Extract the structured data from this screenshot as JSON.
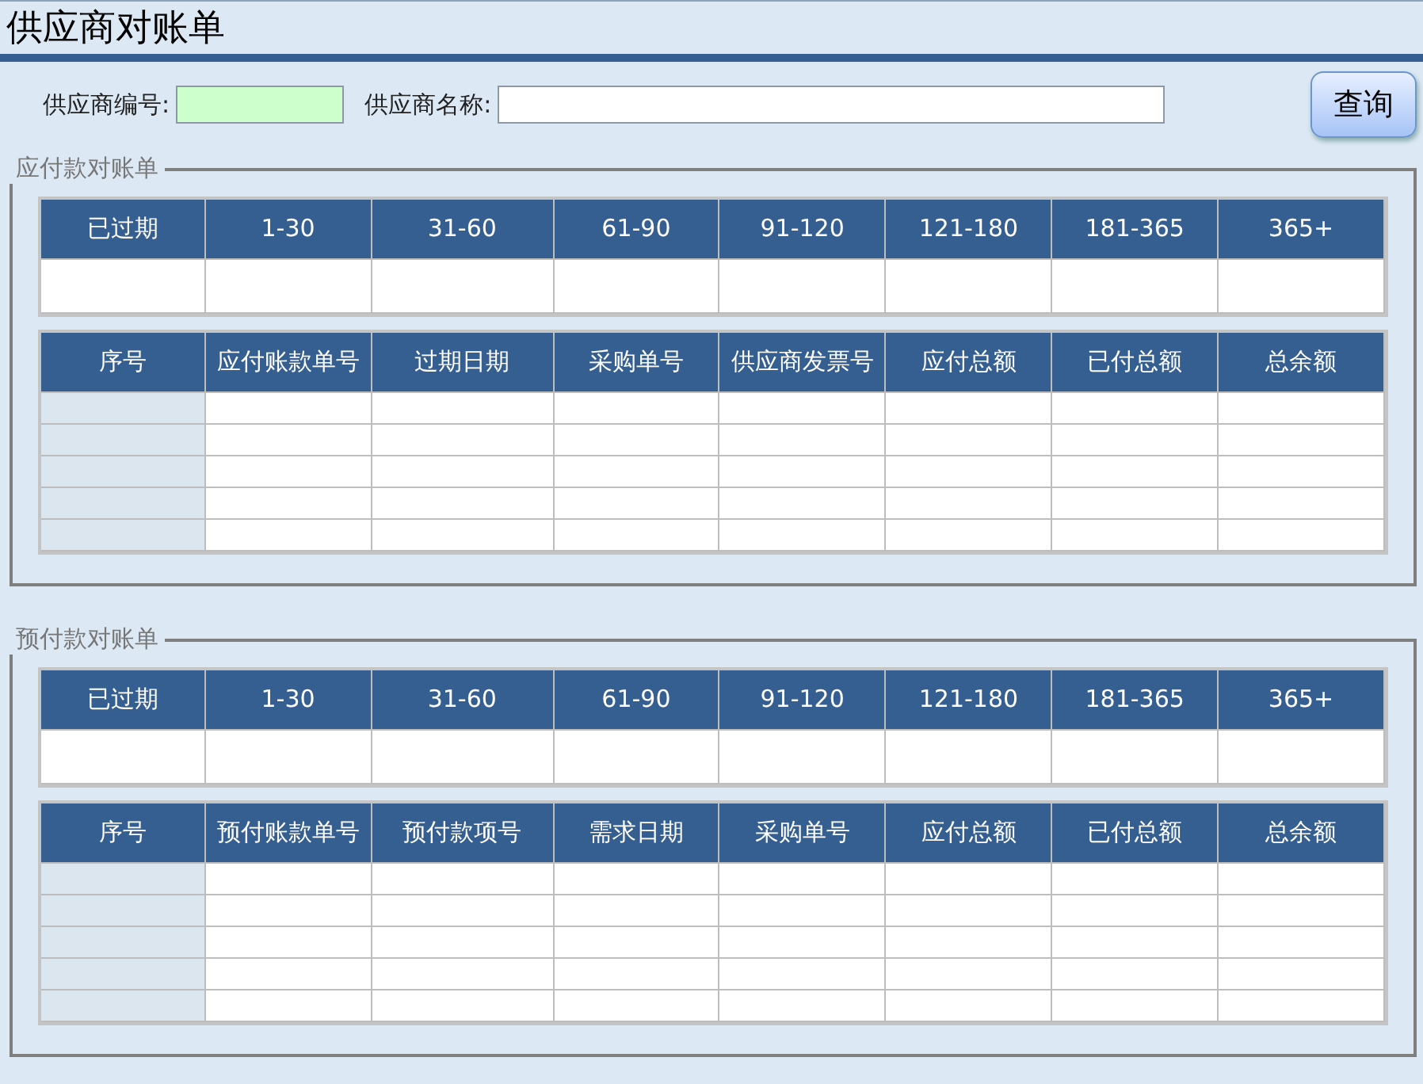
{
  "title": "供应商对账单",
  "search": {
    "fields": [
      {
        "label": "供应商编号:",
        "highlighted": true
      },
      {
        "label": "供应商名称:",
        "highlighted": false
      }
    ],
    "button": "查询"
  },
  "sections": [
    {
      "legend": "应付款对账单",
      "aging_columns": [
        "已过期",
        "1-30",
        "31-60",
        "61-90",
        "91-120",
        "121-180",
        "181-365",
        "365+"
      ],
      "detail_columns": [
        "序号",
        "应付账款单号",
        "过期日期",
        "采购单号",
        "供应商发票号",
        "应付总额",
        "已付总额",
        "总余额"
      ]
    },
    {
      "legend": "预付款对账单",
      "aging_columns": [
        "已过期",
        "1-30",
        "31-60",
        "61-90",
        "91-120",
        "121-180",
        "181-365",
        "365+"
      ],
      "detail_columns": [
        "序号",
        "预付账款单号",
        "预付款项号",
        "需求日期",
        "采购单号",
        "应付总额",
        "已付总额",
        "总余额"
      ]
    }
  ]
}
